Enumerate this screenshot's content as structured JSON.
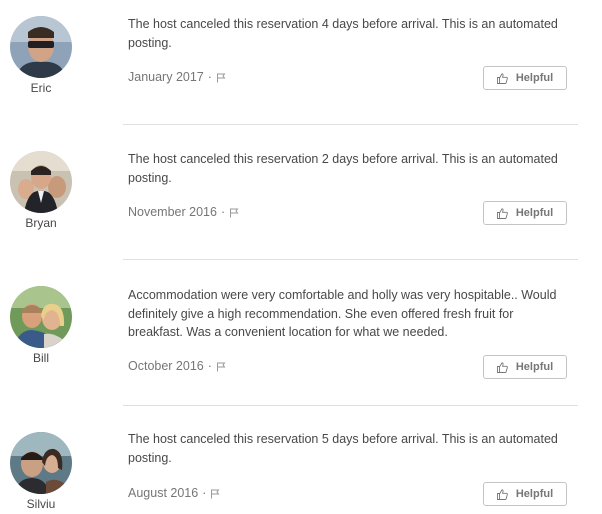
{
  "reviews": [
    {
      "author": "Eric",
      "text": "The host canceled this reservation 4 days before arrival. This is an automated posting.",
      "date": "January 2017",
      "separator": "·",
      "helpful_label": "Helpful"
    },
    {
      "author": "Bryan",
      "text": "The host canceled this reservation 2 days before arrival. This is an automated posting.",
      "date": "November 2016",
      "separator": "·",
      "helpful_label": "Helpful"
    },
    {
      "author": "Bill",
      "text": "Accommodation were very comfortable and holly was very hospitable.. Would definitely give a high recommendation. She even offered fresh fruit for breakfast. Was a convenient location for what we needed.",
      "date": "October 2016",
      "separator": "·",
      "helpful_label": "Helpful"
    },
    {
      "author": "Silviu",
      "text": "The host canceled this reservation 5 days before arrival. This is an automated posting.",
      "date": "August 2016",
      "separator": "·",
      "helpful_label": "Helpful"
    }
  ],
  "icons": {
    "flag": "flag-icon",
    "helpful": "thumbs-up-icon"
  },
  "colors": {
    "text": "#484848",
    "muted": "#767676",
    "border": "#c4c4c4",
    "divider": "#dce0e0"
  }
}
